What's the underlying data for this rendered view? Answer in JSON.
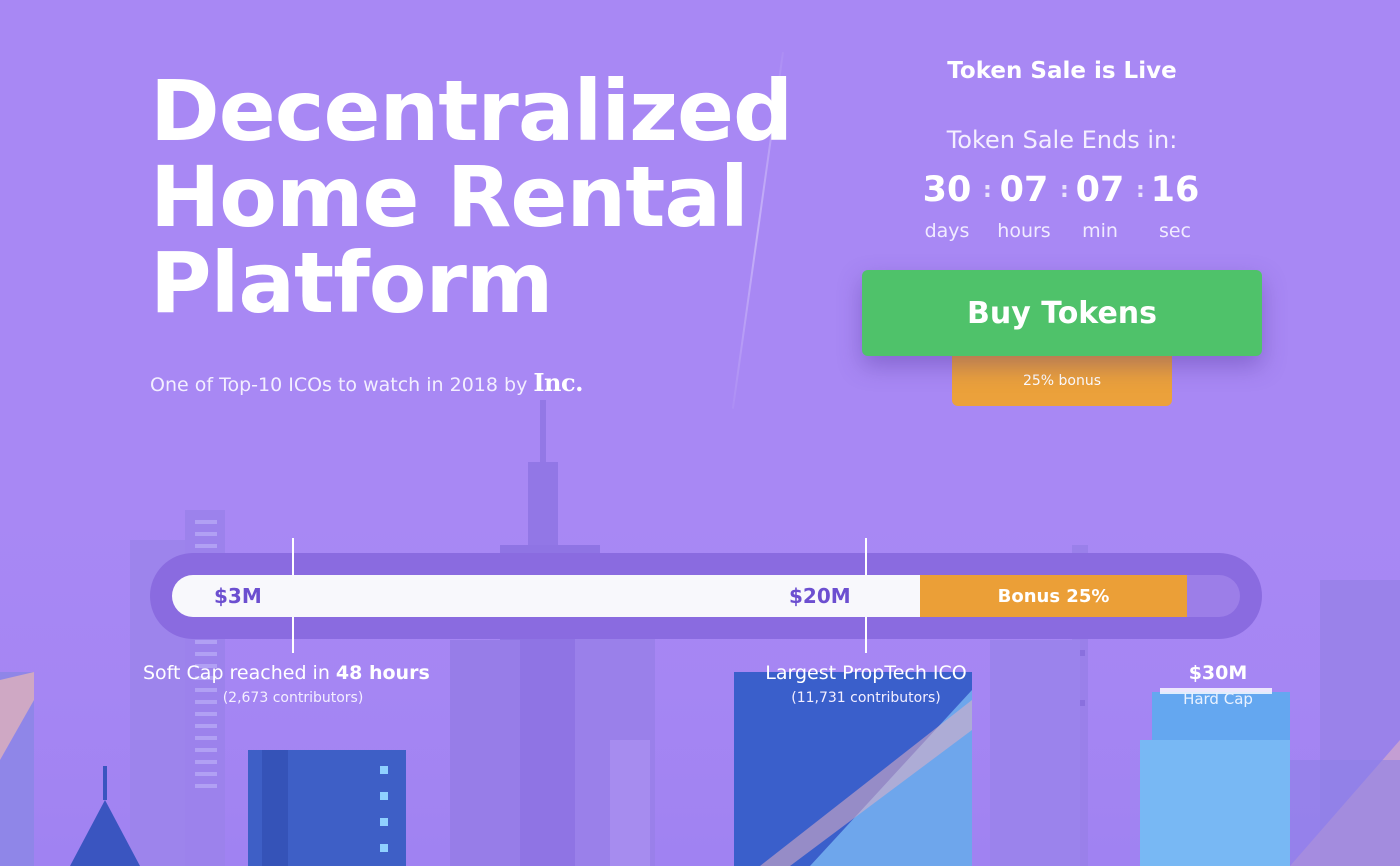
{
  "hero": {
    "title_lines": [
      "Decentralized",
      "Home Rental",
      "Platform"
    ],
    "subtitle": "One of Top-10 ICOs to watch in 2018 by",
    "publisher_logo": "Inc."
  },
  "sale": {
    "status": "Token Sale is Live",
    "ends_label": "Token Sale Ends in:",
    "countdown": [
      {
        "value": "30",
        "unit": "days"
      },
      {
        "value": "07",
        "unit": "hours"
      },
      {
        "value": "07",
        "unit": "min"
      },
      {
        "value": "16",
        "unit": "sec"
      }
    ],
    "buy_label": "Buy Tokens",
    "bonus_label": "25% bonus"
  },
  "progress": {
    "raised_fraction": 0.7,
    "bonus_segment_start_fraction": 0.7,
    "bonus_segment_end_fraction": 0.95,
    "bonus_label": "Bonus 25%",
    "milestones": [
      {
        "amount": "$3M",
        "title_prefix": "Soft Cap reached in",
        "title_bold": "48 hours",
        "subtitle": "(2,673 contributors)"
      },
      {
        "amount": "$20M",
        "title_prefix": "Largest PropTech ICO",
        "title_bold": "",
        "subtitle": "(11,731 contributors)"
      }
    ],
    "hard_cap": {
      "amount": "$30M",
      "label": "Hard Cap"
    }
  },
  "colors": {
    "background": "#a888f4",
    "buy_button": "#4fc26a",
    "bonus": "#eba13b",
    "progress_track": "#8a6be0",
    "progress_fill": "#f8f8fc",
    "milestone_amount": "#6c4fd0"
  }
}
